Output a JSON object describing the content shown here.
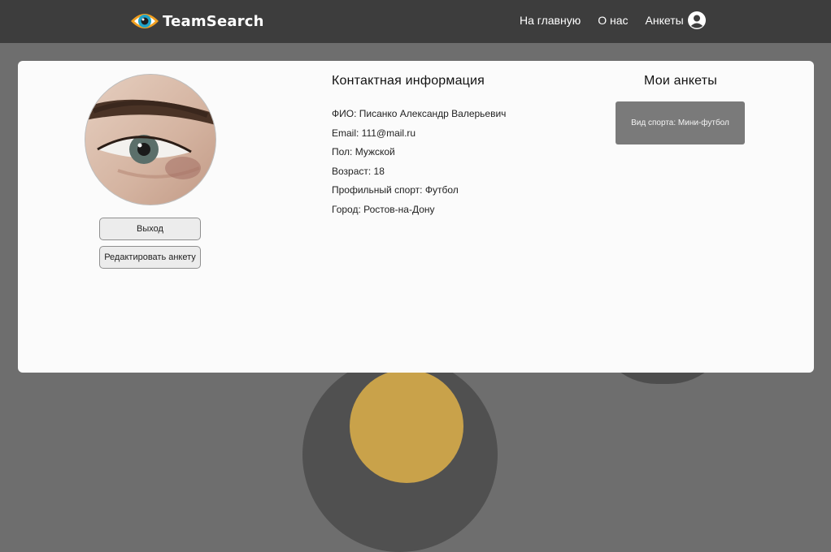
{
  "header": {
    "brand": "TeamSearch",
    "logo_icon": "eye-logo-icon",
    "nav": [
      {
        "label": "На главную"
      },
      {
        "label": "О нас"
      },
      {
        "label": "Анкеты"
      }
    ],
    "user_icon": "user-circle-icon"
  },
  "profile": {
    "avatar_icon": "eye-photo",
    "logout_label": "Выход",
    "edit_label": "Редактировать анкету"
  },
  "contact": {
    "title": "Контактная информация",
    "rows": [
      "ФИО: Писанко Александр Валерьевич",
      "Email: 111@mail.ru",
      "Пол: Мужской",
      "Возраст: 18",
      "Профильный спорт: Футбол",
      "Город: Ростов-на-Дону"
    ]
  },
  "my_profiles": {
    "title": "Мои анкеты",
    "items": [
      {
        "label": "Вид спорта: Мини-футбол"
      }
    ]
  },
  "colors": {
    "header_bg": "#3d3d3d",
    "page_bg": "#6e6e6e",
    "card_bg": "#fbfbfb",
    "profile_card_bg": "#7a7a7a",
    "logo_orange": "#f0a020"
  }
}
